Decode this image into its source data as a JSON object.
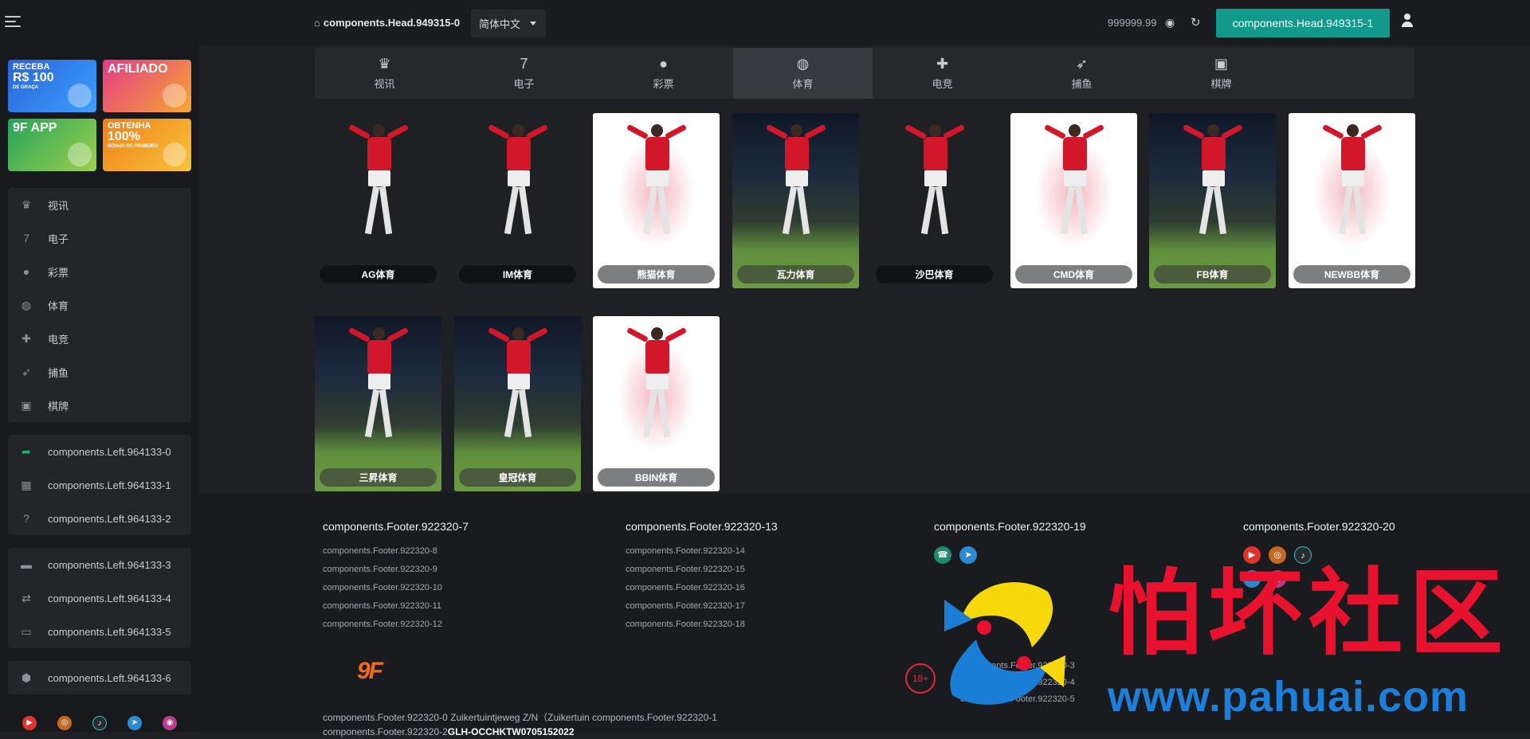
{
  "sidebar": {
    "promos": [
      {
        "l1": "RECEBA",
        "l2": "R$ 100",
        "l3": "DE GRAÇA"
      },
      {
        "l1": "",
        "l2": "AFILIADO",
        "l3": ""
      },
      {
        "l1": "",
        "l2": "9F APP",
        "l3": ""
      },
      {
        "l1": "OBTENHA",
        "l2": "100%",
        "l3": "BÔNUS DE PRIMEIRO"
      }
    ],
    "games": [
      {
        "label": "视讯",
        "icon": "live-dealer-icon"
      },
      {
        "label": "电子",
        "icon": "slot-icon"
      },
      {
        "label": "彩票",
        "icon": "lottery-icon"
      },
      {
        "label": "体育",
        "icon": "sports-icon"
      },
      {
        "label": "电竞",
        "icon": "gamepad-icon"
      },
      {
        "label": "捕鱼",
        "icon": "fishing-icon"
      },
      {
        "label": "棋牌",
        "icon": "cards-icon"
      }
    ],
    "links_a": [
      {
        "label": "components.Left.964133-0",
        "icon": "share-icon"
      },
      {
        "label": "components.Left.964133-1",
        "icon": "gift-icon"
      },
      {
        "label": "components.Left.964133-2",
        "icon": "help-icon"
      }
    ],
    "links_b": [
      {
        "label": "components.Left.964133-3",
        "icon": "wallet-icon"
      },
      {
        "label": "components.Left.964133-4",
        "icon": "exchange-icon"
      },
      {
        "label": "components.Left.964133-5",
        "icon": "card-icon"
      }
    ],
    "links_c": [
      {
        "label": "components.Left.964133-6",
        "icon": "cube-icon"
      }
    ]
  },
  "header": {
    "home_label": "components.Head.949315-0",
    "language": "简体中文",
    "balance": "999999.99",
    "action_button": "components.Head.949315-1"
  },
  "tabs": [
    {
      "label": "视讯",
      "icon": "live-dealer-icon",
      "active": false
    },
    {
      "label": "电子",
      "icon": "slot-icon",
      "active": false
    },
    {
      "label": "彩票",
      "icon": "lottery-icon",
      "active": false
    },
    {
      "label": "体育",
      "icon": "sports-icon",
      "active": true
    },
    {
      "label": "电竞",
      "icon": "gamepad-icon",
      "active": false
    },
    {
      "label": "捕鱼",
      "icon": "fishing-icon",
      "active": false
    },
    {
      "label": "棋牌",
      "icon": "cards-icon",
      "active": false
    }
  ],
  "games": [
    {
      "label": "AG体育",
      "style": "dark"
    },
    {
      "label": "IM体育",
      "style": "dark"
    },
    {
      "label": "熊猫体育",
      "style": "white"
    },
    {
      "label": "瓦力体育",
      "style": "stadium"
    },
    {
      "label": "沙巴体育",
      "style": "dark"
    },
    {
      "label": "CMD体育",
      "style": "white"
    },
    {
      "label": "FB体育",
      "style": "stadium"
    },
    {
      "label": "NEWBB体育",
      "style": "white"
    },
    {
      "label": "三昇体育",
      "style": "stadium"
    },
    {
      "label": "皇冠体育",
      "style": "stadium"
    },
    {
      "label": "BBIN体育",
      "style": "white"
    }
  ],
  "footer": {
    "col1": {
      "title": "components.Footer.922320-7",
      "links": [
        "components.Footer.922320-8",
        "components.Footer.922320-9",
        "components.Footer.922320-10",
        "components.Footer.922320-11",
        "components.Footer.922320-12"
      ]
    },
    "col2": {
      "title": "components.Footer.922320-13",
      "links": [
        "components.Footer.922320-14",
        "components.Footer.922320-15",
        "components.Footer.922320-16",
        "components.Footer.922320-17",
        "components.Footer.922320-18"
      ]
    },
    "col3": {
      "title": "components.Footer.922320-19"
    },
    "col4": {
      "title": "components.Footer.922320-20"
    },
    "logo": "9F",
    "age_badge": "18+",
    "address_line1": "components.Footer.922320-0 Zuikertuintjeweg Z/N（Zuikertuin components.Footer.922320-1",
    "address_line2_prefix": "components.Footer.922320-2",
    "address_line2_bold": "GLH-OCCHKTW0705152022",
    "faint": [
      "components.Footer.922320-3",
      "components.Footer.922320-4",
      "components.Footer.922320-5"
    ]
  },
  "watermark": {
    "cn": "怕坏社区",
    "url": "www.pahuai.com"
  }
}
